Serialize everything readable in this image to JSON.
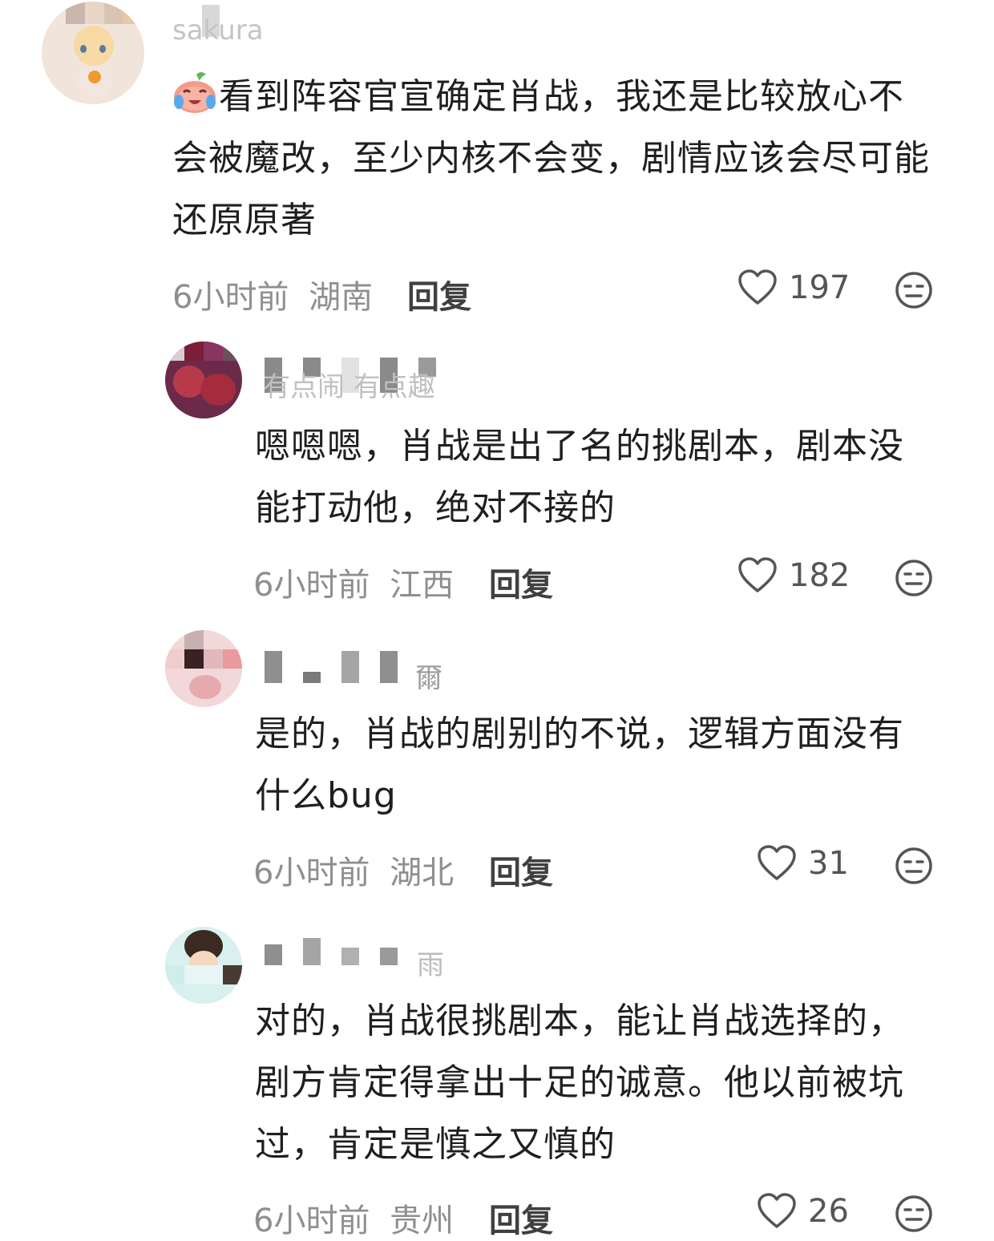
{
  "comments": [
    {
      "username": "sakura",
      "text": "看到阵容官宣确定肖战，我还是比较放心不会被魔改，至少内核不会变，剧情应该会尽可能还原原著",
      "time": "6小时前",
      "location": "湖南",
      "reply_label": "回复",
      "likes": "197",
      "has_emoji": true,
      "emoji": "crying-laughing-emoji"
    },
    {
      "username": "有点闹 有点趣",
      "text": "嗯嗯嗯，肖战是出了名的挑剧本，剧本没能打动他，绝对不接的",
      "time": "6小时前",
      "location": "江西",
      "reply_label": "回复",
      "likes": "182"
    },
    {
      "username": "爾",
      "text": "是的，肖战的剧别的不说，逻辑方面没有什么bug",
      "time": "6小时前",
      "location": "湖北",
      "reply_label": "回复",
      "likes": "31"
    },
    {
      "username": "雨",
      "text": "对的，肖战很挑剧本，能让肖战选择的，剧方肯定得拿出十足的诚意。他以前被坑过，肯定是慎之又慎的",
      "time": "6小时前",
      "location": "贵州",
      "reply_label": "回复",
      "likes": "26"
    }
  ],
  "colors": {
    "text": "#1f1f1f",
    "meta": "#8f8f8f",
    "icon": "#555555"
  }
}
